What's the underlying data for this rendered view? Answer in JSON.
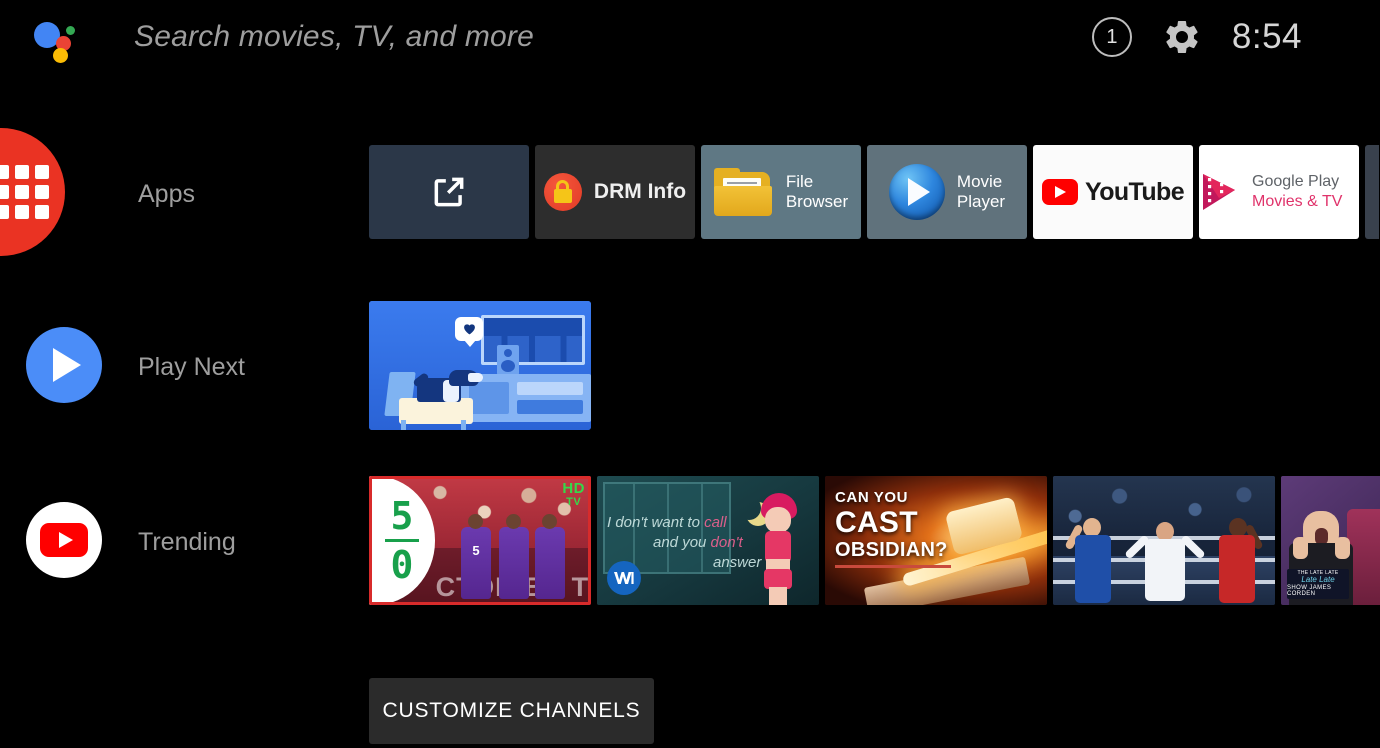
{
  "topbar": {
    "assistant_icon": "google-assistant-icon",
    "search_placeholder": "Search movies, TV, and more",
    "notification_count": "1",
    "settings_icon": "gear-icon",
    "clock": "8:54"
  },
  "rows": [
    {
      "id": "apps",
      "label": "Apps",
      "icon": "apps-grid-icon",
      "icon_color": "#EA3323"
    },
    {
      "id": "play_next",
      "label": "Play Next",
      "icon": "play-circle-icon",
      "icon_color": "#4B8DF8"
    },
    {
      "id": "trending",
      "label": "Trending",
      "icon": "youtube-circle-icon",
      "icon_color": "#FF0000"
    }
  ],
  "apps": [
    {
      "name": "open-link-tile",
      "label": "",
      "bg": "#2b3748",
      "icon": "external-link-icon"
    },
    {
      "name": "drm-info-tile",
      "label": "DRM Info",
      "bg": "#2d2d2d",
      "icon": "lock-badge-icon"
    },
    {
      "name": "file-browser-tile",
      "label": "File\nBrowser",
      "bg": "#5f7884",
      "icon": "folder-icon"
    },
    {
      "name": "movie-player-tile",
      "label": "Movie\nPlayer",
      "bg": "#60727c",
      "icon": "play-circle-glossy-icon"
    },
    {
      "name": "youtube-tile",
      "label": "YouTube",
      "bg": "#fbfbfb",
      "icon": "youtube-logo-icon"
    },
    {
      "name": "google-play-tile",
      "label_line1": "Google Play",
      "label_line2": "Movies & TV",
      "bg": "#ffffff",
      "icon": "play-movies-film-icon"
    }
  ],
  "play_next": {
    "card_title": "watch-next-illustration",
    "description": "Blue illustration of a dog on a chair watching a TV with a heart speech bubble"
  },
  "trending": [
    {
      "name": "soccer-highlights-thumbnail",
      "score_top": "5",
      "score_bottom": "0",
      "badge": "HD",
      "badge_sub": "TV",
      "overlay_text": "CTOR BY TV",
      "player_number": "5"
    },
    {
      "name": "lyric-video-thumbnail",
      "line1_a": "I don't want to ",
      "line1_b": "call",
      "line2_a": "and you ",
      "line2_b": "don't",
      "line3": "answer",
      "label_logo": "warner-music-icon"
    },
    {
      "name": "cast-obsidian-thumbnail",
      "title_line1": "CAN YOU",
      "title_line2": "CAST",
      "title_line3": "OBSIDIAN?"
    },
    {
      "name": "boxing-match-thumbnail"
    },
    {
      "name": "late-late-show-thumbnail",
      "logo_line1": "THE LATE LATE",
      "logo_line2": "Late Late",
      "logo_line3": "SHOW JAMES CORDEN"
    }
  ],
  "footer": {
    "customize_channels_label": "CUSTOMIZE CHANNELS"
  }
}
